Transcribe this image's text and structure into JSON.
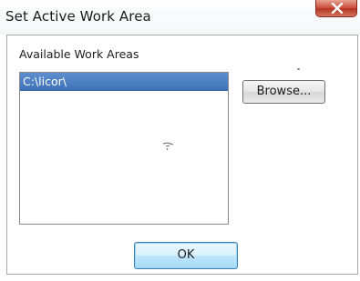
{
  "window": {
    "title": "Set Active Work Area"
  },
  "title_bar": {
    "close_icon": "close-icon"
  },
  "content": {
    "group_label": "Available Work Areas",
    "work_areas": [
      "C:\\licor\\"
    ],
    "selected_index": 0
  },
  "buttons": {
    "browse_label": "Browse...",
    "ok_label": "OK"
  },
  "colors": {
    "selection": "#4a7dc1",
    "close_button": "#c94a36",
    "default_button_border": "#3c7fb1"
  }
}
